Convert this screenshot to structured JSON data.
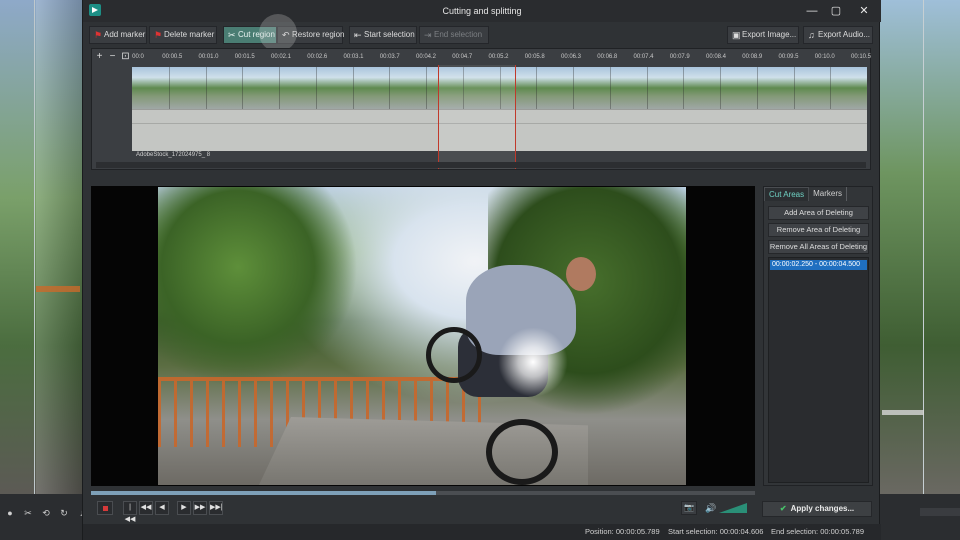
{
  "window": {
    "title": "Cutting and splitting",
    "minimize": "—",
    "maximize": "▢",
    "close": "✕"
  },
  "toolbar": {
    "add_marker": "Add marker",
    "delete_marker": "Delete marker",
    "cut_region": "Cut region",
    "restore_region": "Restore region",
    "start_selection": "Start selection",
    "end_selection": "End selection",
    "export_image": "Export Image...",
    "export_audio": "Export Audio..."
  },
  "timeline": {
    "zoom_in": "+",
    "zoom_out": "−",
    "fit": "⊡",
    "ticks": [
      "00:0",
      "00:00.5",
      "00:01.0",
      "00:01.5",
      "00:02.1",
      "00:02.6",
      "00:03.1",
      "00:03.7",
      "00:04.2",
      "00:04.7",
      "00:05.2",
      "00:05.8",
      "00:06.3",
      "00:06.8",
      "00:07.4",
      "00:07.9",
      "00:08.4",
      "00:08.9",
      "00:09.5",
      "00:10.0",
      "00:10.5"
    ],
    "clip_name": "AdobeStock_172024975_ 8"
  },
  "side_panel": {
    "tabs": [
      "Cut Areas",
      "Markers"
    ],
    "add_area": "Add Area of Deleting",
    "remove_area": "Remove Area of Deleting",
    "remove_all": "Remove All Areas of Deleting",
    "areas": [
      "00:00:02.250 - 00:00:04.500"
    ]
  },
  "playback": {
    "record": "",
    "first": "|◀◀",
    "prev_frame": "◀◀",
    "back": "◀",
    "play": "▶",
    "forward": "▶▶",
    "last": "▶▶|",
    "snapshot": "📷",
    "volume": "🔊",
    "seek_progress": 0.52
  },
  "apply_button": "Apply changes...",
  "status": {
    "position": "Position: 00:00:05.789",
    "start_selection": "Start selection: 00:00:04.606",
    "end_selection": "End selection: 00:00:05.789"
  },
  "colors": {
    "accent": "#4a7d73",
    "selection": "#1f6fc0",
    "marker": "#c0392b"
  }
}
